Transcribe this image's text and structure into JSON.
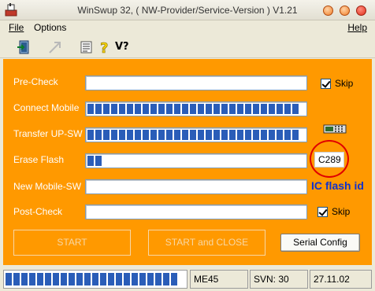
{
  "window": {
    "title": "WinSwup 32, ( NW-Provider/Service-Version ) V1.21"
  },
  "menu": {
    "file": "File",
    "options": "Options",
    "help": "Help"
  },
  "toolbar": {
    "icons": [
      "exit-door-icon",
      "arrow-tool-icon",
      "list-icon",
      "help-question-icon",
      "version-query-icon"
    ],
    "version_label": "V?"
  },
  "panel": {
    "colors": {
      "background": "#ff9900",
      "progress": "#2a5db8",
      "annotation": "#e00000",
      "annotation_text": "#1133cc"
    },
    "steps": [
      {
        "label": "Pre-Check",
        "progress": 0,
        "skip": "Skip",
        "skip_checked": true
      },
      {
        "label": "Connect Mobile",
        "progress": 1
      },
      {
        "label": "Transfer UP-SW",
        "progress": 1
      },
      {
        "label": "Erase Flash",
        "progress": 0.07
      },
      {
        "label": "New Mobile-SW",
        "progress": 0
      },
      {
        "label": "Post-Check",
        "progress": 0,
        "skip": "Skip",
        "skip_checked": true
      }
    ],
    "flash_id": "C289",
    "annotation": "IC flash id",
    "buttons": {
      "start": "START",
      "start_close": "START and CLOSE",
      "serial_config": "Serial Config"
    }
  },
  "status": {
    "progress": 1,
    "model": "ME45",
    "svn": "SVN: 30",
    "date": "27.11.02"
  }
}
